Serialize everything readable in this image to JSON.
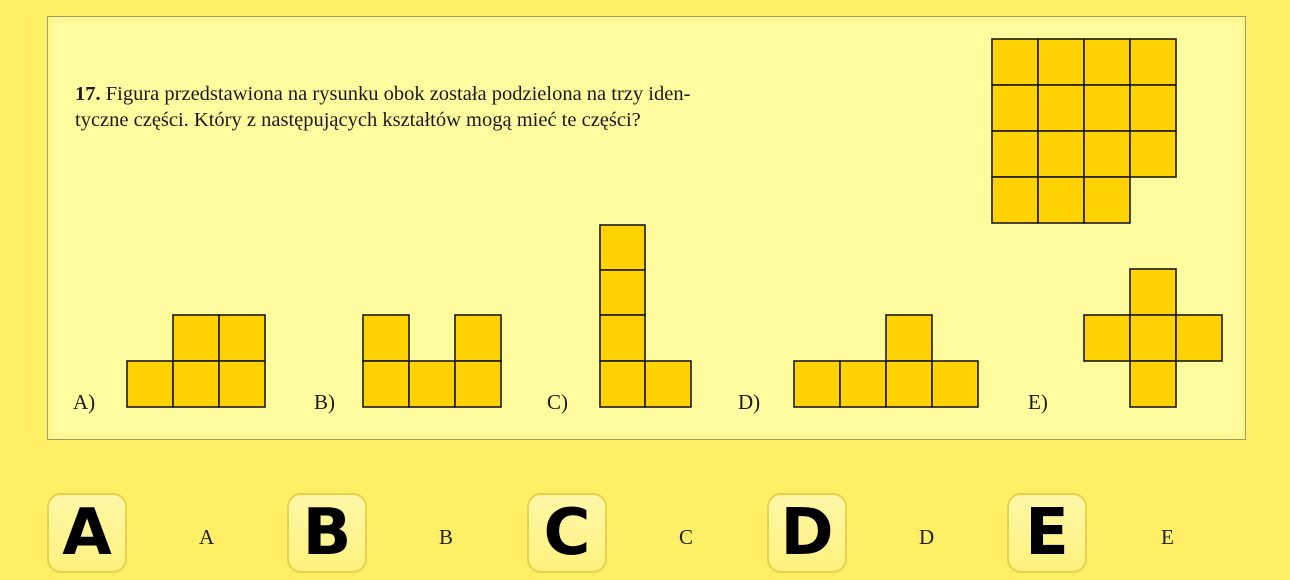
{
  "question": {
    "number": "17.",
    "line1": "Figura przedstawiona na rysunku obok została podzielona na trzy iden-",
    "line2": "tyczne części. Który z następujących kształtów mogą mieć te części?"
  },
  "options": [
    {
      "label": "A)"
    },
    {
      "label": "B)"
    },
    {
      "label": "C)"
    },
    {
      "label": "D)"
    },
    {
      "label": "E)"
    }
  ],
  "answers": [
    {
      "letter": "A",
      "text": "A"
    },
    {
      "letter": "B",
      "text": "B"
    },
    {
      "letter": "C",
      "text": "C"
    },
    {
      "letter": "D",
      "text": "D"
    },
    {
      "letter": "E",
      "text": "E"
    }
  ],
  "colors": {
    "page_background": "#ffef66",
    "card_background": "#fffca0",
    "cell_fill": "#ffd200",
    "cell_stroke": "#1a1a1a"
  }
}
